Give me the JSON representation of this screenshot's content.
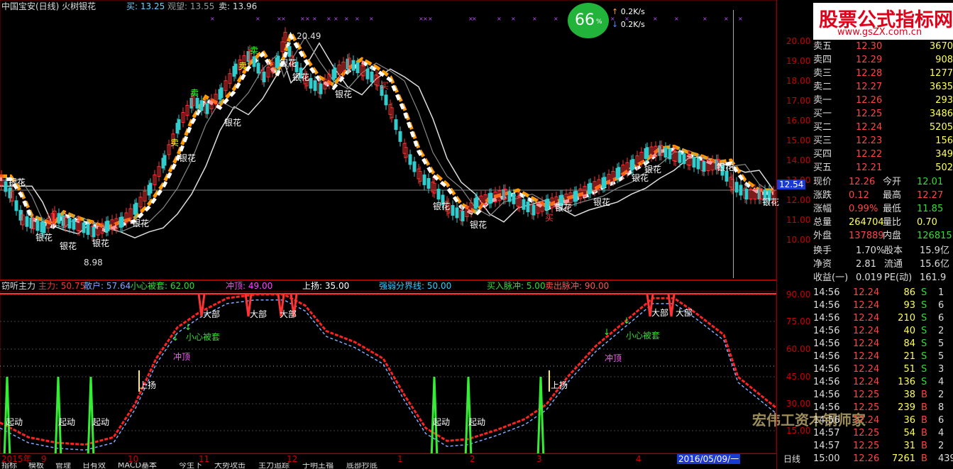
{
  "window": {
    "title": "中国宝安(日线) 火树银花",
    "top_sell_label": "买: 13.25",
    "top_watch_label": "观望: 13.55",
    "top_sell2_label": "卖: 13.96"
  },
  "overlay": {
    "percent": "66",
    "percent_sign": "%",
    "up_speed": "0.2K/s",
    "down_speed": "0.2K/s",
    "banner": "股票公式指标网",
    "banner_url": "www.gsZX.com.cn",
    "watermark": "宏伟工资木钢师家"
  },
  "price_axis": {
    "ticks": [
      "20.00",
      "19.00",
      "18.00",
      "17.00",
      "16.00",
      "15.00",
      "14.00",
      "13.00",
      "12.00",
      "11.00",
      "10.00"
    ],
    "current_label": "12.54"
  },
  "annotations": {
    "high_label": "20.49",
    "low_label": "8.98",
    "yinhua": "银花",
    "sell": "卖",
    "buy": "买"
  },
  "indicator": {
    "name": "窃听主力",
    "legend": [
      {
        "text": "主力: 50.75",
        "color": "#ff3333"
      },
      {
        "text": "散户: 57.64",
        "color": "#7fa8ff"
      },
      {
        "text": "小心被套: 62.00",
        "color": "#33dd33"
      },
      {
        "text": "冲顶: 49.00",
        "color": "#ff44ff"
      },
      {
        "text": "上扬: 35.00",
        "color": "#ffffff"
      },
      {
        "text": "强弱分界线: 50.00",
        "color": "#33ccff"
      },
      {
        "text": "买入脉冲: 5.00",
        "color": "#33dd33"
      },
      {
        "text": "卖出脉冲: 90.00",
        "color": "#ff5555"
      }
    ],
    "axis_ticks": [
      "90.00",
      "75.00",
      "60.00",
      "45.00",
      "30.00",
      "15.00"
    ],
    "labels": {
      "top": "大部",
      "trap": "小心被套",
      "peak": "冲顶",
      "rise": "上扬",
      "start": "起动"
    }
  },
  "date_axis": {
    "items": [
      "2015年",
      "9",
      "10",
      "11",
      "12",
      "1",
      "2",
      "3",
      "4"
    ],
    "cursor_date": "2016/05/09/一",
    "period": "日线"
  },
  "bottom_tabs": [
    "指标",
    "模板",
    "管理",
    "日有效",
    "MACD基本",
    "今生下",
    "大势攻击",
    "主力追踪",
    "于明王福",
    "底部抄底"
  ],
  "quote": {
    "asks": [
      {
        "label": "卖五",
        "price": "12.30",
        "vol": "3670"
      },
      {
        "label": "卖四",
        "price": "12.29",
        "vol": "908"
      },
      {
        "label": "卖三",
        "price": "12.28",
        "vol": "1277"
      },
      {
        "label": "卖二",
        "price": "12.27",
        "vol": "3635"
      },
      {
        "label": "卖一",
        "price": "12.26",
        "vol": "293"
      }
    ],
    "bids": [
      {
        "label": "买一",
        "price": "12.25",
        "vol": "3486"
      },
      {
        "label": "买二",
        "price": "12.24",
        "vol": "5205"
      },
      {
        "label": "买三",
        "price": "12.23",
        "vol": "156"
      },
      {
        "label": "买四",
        "price": "12.22",
        "vol": "349"
      },
      {
        "label": "买五",
        "price": "12.21",
        "vol": "502"
      }
    ],
    "stats": [
      {
        "l1": "现价",
        "v1": "12.26",
        "c1": "#ff4444",
        "l2": "今开",
        "v2": "12.01",
        "c2": "#33dd33"
      },
      {
        "l1": "涨跌",
        "v1": "0.12",
        "c1": "#ff4444",
        "l2": "最高",
        "v2": "12.27",
        "c2": "#ff4444"
      },
      {
        "l1": "涨幅",
        "v1": "0.99%",
        "c1": "#ff4444",
        "l2": "最低",
        "v2": "11.85",
        "c2": "#33dd33"
      },
      {
        "l1": "总量",
        "v1": "264704",
        "c1": "#ffff55",
        "l2": "量比",
        "v2": "0.70",
        "c2": "#ffff55"
      },
      {
        "l1": "外盘",
        "v1": "137889",
        "c1": "#ff4444",
        "l2": "内盘",
        "v2": "126815",
        "c2": "#33dd33"
      }
    ],
    "stats2": [
      {
        "l1": "换手",
        "v1": "1.70%",
        "l2": "股本",
        "v2": "15.9亿"
      },
      {
        "l1": "净资",
        "v1": "2.81",
        "l2": "流通",
        "v2": "15.6亿"
      },
      {
        "l1": "收益(一)",
        "v1": "0.019",
        "l2": "PE(动)",
        "v2": "161.9"
      }
    ],
    "ticks": [
      {
        "time": "14:56",
        "price": "12.24",
        "vol": "86",
        "side": "S",
        "n": "1"
      },
      {
        "time": "14:56",
        "price": "12.24",
        "vol": "93",
        "side": "S",
        "n": "6"
      },
      {
        "time": "14:56",
        "price": "12.24",
        "vol": "210",
        "side": "S",
        "n": "6"
      },
      {
        "time": "14:56",
        "price": "12.24",
        "vol": "40",
        "side": "S",
        "n": "2"
      },
      {
        "time": "14:56",
        "price": "12.24",
        "vol": "84",
        "side": "S",
        "n": "5"
      },
      {
        "time": "14:56",
        "price": "12.24",
        "vol": "21",
        "side": "S",
        "n": "5"
      },
      {
        "time": "14:56",
        "price": "12.24",
        "vol": "51",
        "side": "S",
        "n": "3"
      },
      {
        "time": "14:56",
        "price": "12.24",
        "vol": "136",
        "side": "S",
        "n": "4"
      },
      {
        "time": "14:56",
        "price": "12.25",
        "vol": "38",
        "side": "B",
        "n": "2"
      },
      {
        "time": "14:56",
        "price": "12.25",
        "vol": "239",
        "side": "B",
        "n": "8"
      },
      {
        "time": "14:56",
        "price": "12.24",
        "vol": "36",
        "side": "B",
        "n": "6"
      },
      {
        "time": "14:57",
        "price": "12.25",
        "vol": "54",
        "side": "B",
        "n": "4"
      },
      {
        "time": "14:57",
        "price": "12.25",
        "vol": "31",
        "side": "B",
        "n": "2"
      },
      {
        "time": "15:00",
        "price": "12.26",
        "vol": "7261",
        "side": "B",
        "n": "439"
      }
    ]
  }
}
